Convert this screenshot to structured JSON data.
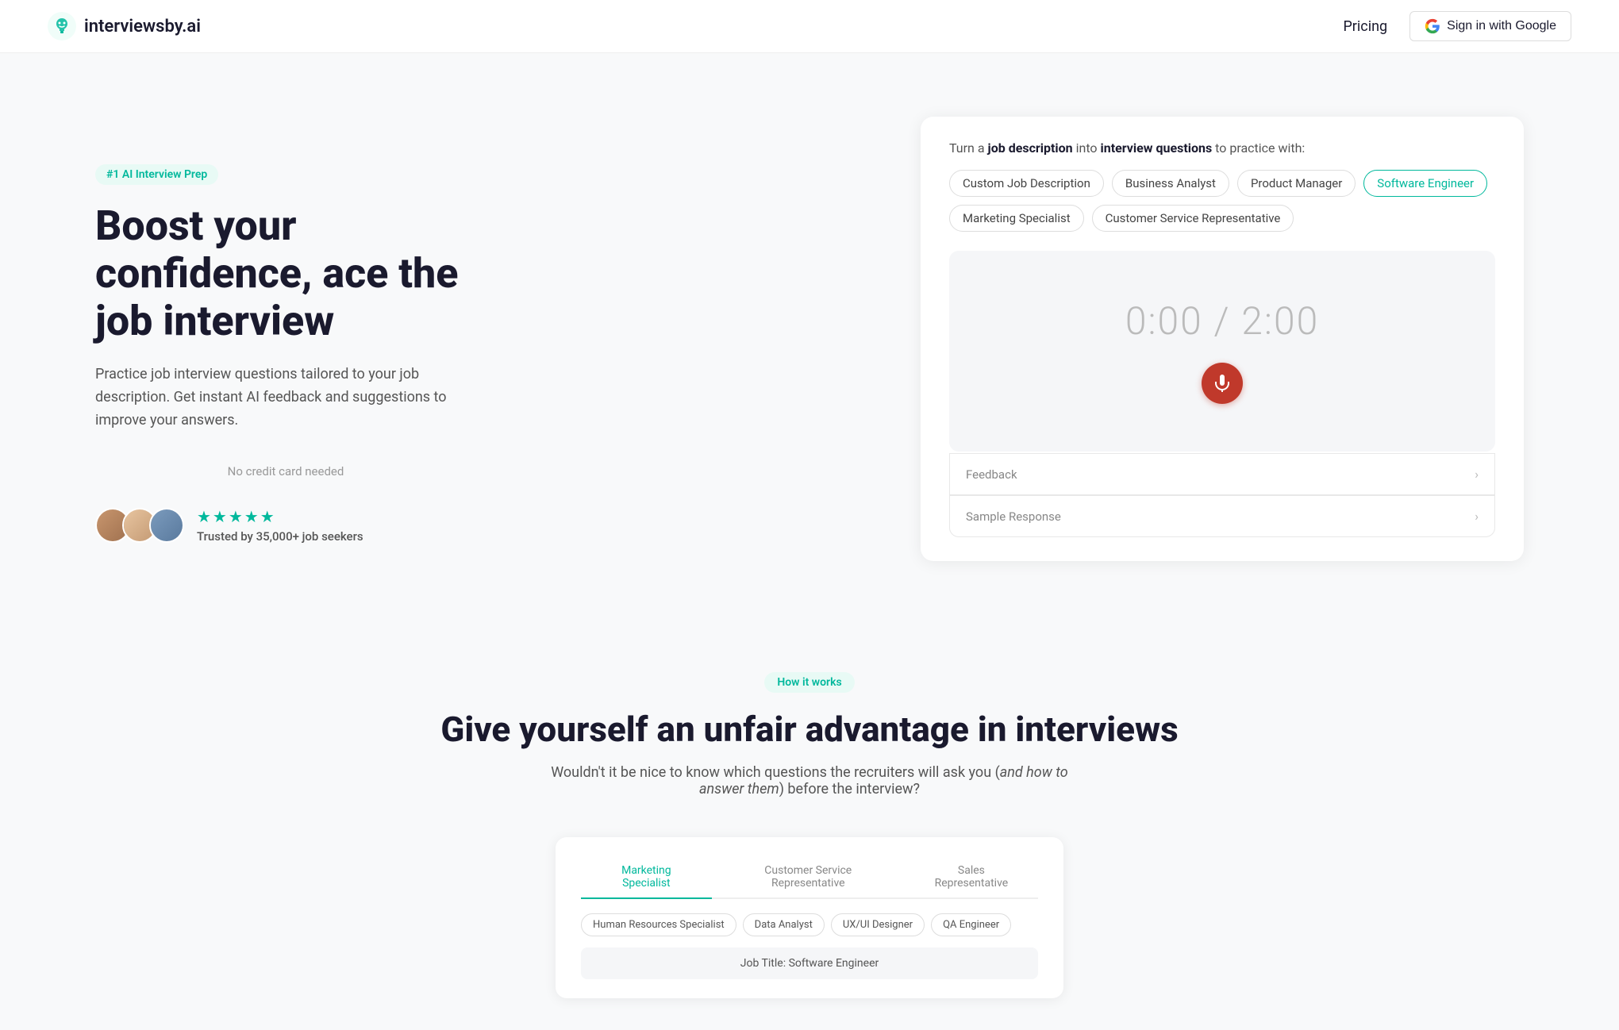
{
  "navbar": {
    "logo_text": "interviewsby.ai",
    "pricing_label": "Pricing",
    "signin_label": "Sign in with Google"
  },
  "hero": {
    "badge": "#1 AI Interview Prep",
    "title": "Boost your confidence, ace the job interview",
    "subtitle": "Practice job interview questions tailored to your job description. Get instant AI feedback and suggestions to improve your answers.",
    "no_credit": "No credit card needed",
    "stars": "★★★★★",
    "proof_label": "Trusted by 35,000+ job seekers"
  },
  "card": {
    "intro_text": "Turn a ",
    "intro_bold1": "job description",
    "intro_mid": " into ",
    "intro_bold2": "interview questions",
    "intro_end": " to practice with:",
    "tags": [
      {
        "label": "Custom Job Description",
        "active": false
      },
      {
        "label": "Business Analyst",
        "active": false
      },
      {
        "label": "Product Manager",
        "active": false
      },
      {
        "label": "Software Engineer",
        "active": true
      },
      {
        "label": "Marketing Specialist",
        "active": false
      },
      {
        "label": "Customer Service Representative",
        "active": false
      }
    ],
    "timer": "0:00 / 2:00",
    "feedback_label": "Feedback",
    "sample_label": "Sample Response"
  },
  "how_section": {
    "badge": "How it works",
    "title": "Give yourself an unfair advantage in interviews",
    "subtitle_start": "Wouldn't it be nice to know which questions the recruiters will ask you (",
    "subtitle_italic": "and how to answer them",
    "subtitle_end": ") before the interview?"
  },
  "bottom_card": {
    "tabs": [
      {
        "label": "Marketing Specialist",
        "active": false
      },
      {
        "label": "Customer Service Representative",
        "active": false
      },
      {
        "label": "Sales Representative",
        "active": false
      }
    ],
    "tags_row2": [
      {
        "label": "Human Resources Specialist"
      },
      {
        "label": "Data Analyst"
      },
      {
        "label": "UX/UI Designer"
      },
      {
        "label": "QA Engineer"
      }
    ],
    "job_title": "Job Title: Software Engineer"
  }
}
